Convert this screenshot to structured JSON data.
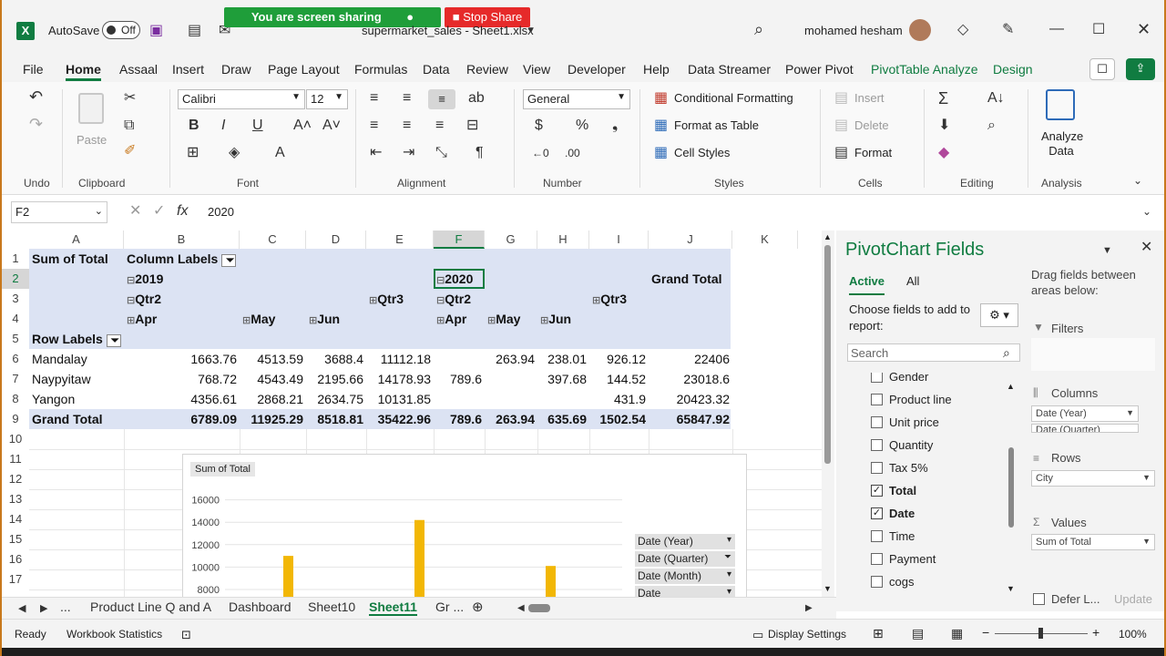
{
  "titlebar": {
    "autosave_label": "AutoSave",
    "toggle_state": "Off",
    "filename": "supermarket_sales - Sheet1.xlsx",
    "sharing_banner": "You are screen sharing",
    "stop_share": "Stop Share",
    "user": "mohamed hesham"
  },
  "menu": [
    "File",
    "Home",
    "Assaal",
    "Insert",
    "Draw",
    "Page Layout",
    "Formulas",
    "Data",
    "Review",
    "View",
    "Developer",
    "Help",
    "Data Streamer",
    "Power Pivot",
    "PivotTable Analyze",
    "Design"
  ],
  "ribbon": {
    "undo": "Undo",
    "clipboard": "Clipboard",
    "paste": "Paste",
    "font_name": "Calibri",
    "font_size": "12",
    "font": "Font",
    "alignment": "Alignment",
    "number_format": "General",
    "number": "Number",
    "cond_format": "Conditional Formatting",
    "format_table": "Format as Table",
    "cell_styles": "Cell Styles",
    "styles": "Styles",
    "insert": "Insert",
    "delete": "Delete",
    "format": "Format",
    "cells": "Cells",
    "editing": "Editing",
    "analyze_data": "Analyze Data",
    "analysis": "Analysis"
  },
  "formula": {
    "namebox": "F2",
    "value": "2020",
    "fx": "fx"
  },
  "columns": [
    "A",
    "B",
    "C",
    "D",
    "E",
    "F",
    "G",
    "H",
    "I",
    "J",
    "K"
  ],
  "rows": [
    "1",
    "2",
    "3",
    "4",
    "5",
    "6",
    "7",
    "8",
    "9",
    "10",
    "11",
    "12",
    "13",
    "14",
    "15",
    "16",
    "17"
  ],
  "pivot": {
    "r1": {
      "a": "Sum of Total",
      "b": "Column Labels"
    },
    "r2": {
      "b": "2019",
      "f": "2020",
      "j": "Grand Total"
    },
    "r3": {
      "b": "Qtr2",
      "e": "Qtr3",
      "f": "Qtr2",
      "i": "Qtr3"
    },
    "r4": {
      "b": "Apr",
      "c": "May",
      "d": "Jun",
      "f": "Apr",
      "g": "May",
      "h": "Jun"
    },
    "r5": {
      "a": "Row Labels"
    },
    "data": [
      {
        "city": "Mandalay",
        "b": "1663.76",
        "c": "4513.59",
        "d": "3688.4",
        "e": "11112.18",
        "f": "",
        "g": "263.94",
        "h": "238.01",
        "i": "926.12",
        "j": "22406"
      },
      {
        "city": "Naypyitaw",
        "b": "768.72",
        "c": "4543.49",
        "d": "2195.66",
        "e": "14178.93",
        "f": "789.6",
        "g": "",
        "h": "397.68",
        "i": "144.52",
        "j": "23018.6"
      },
      {
        "city": "Yangon",
        "b": "4356.61",
        "c": "2868.21",
        "d": "2634.75",
        "e": "10131.85",
        "f": "",
        "g": "",
        "h": "",
        "i": "431.9",
        "j": "20423.32"
      }
    ],
    "total": {
      "city": "Grand Total",
      "b": "6789.09",
      "c": "11925.29",
      "d": "8518.81",
      "e": "35422.96",
      "f": "789.6",
      "g": "263.94",
      "h": "635.69",
      "i": "1502.54",
      "j": "65847.92"
    }
  },
  "chart_data": {
    "type": "bar",
    "title": "Sum of Total",
    "yticks": [
      "16000",
      "14000",
      "12000",
      "10000",
      "8000"
    ],
    "ylim": [
      7000,
      17000
    ],
    "values": [
      11000,
      14200,
      10100
    ],
    "bar_color": "#f2b705",
    "field_buttons": [
      "Date (Year)",
      "Date (Quarter)",
      "Date (Month)",
      "Date"
    ]
  },
  "pane": {
    "title": "PivotChart Fields",
    "tab_active": "Active",
    "tab_all": "All",
    "choose": "Choose fields to add to report:",
    "search_placeholder": "Search",
    "drag": "Drag fields between areas below:",
    "fields": [
      {
        "name": "Gender",
        "checked": false
      },
      {
        "name": "Product line",
        "checked": false
      },
      {
        "name": "Unit price",
        "checked": false
      },
      {
        "name": "Quantity",
        "checked": false
      },
      {
        "name": "Tax 5%",
        "checked": false
      },
      {
        "name": "Total",
        "checked": true
      },
      {
        "name": "Date",
        "checked": true
      },
      {
        "name": "Time",
        "checked": false
      },
      {
        "name": "Payment",
        "checked": false
      },
      {
        "name": "cogs",
        "checked": false
      }
    ],
    "filters": "Filters",
    "columns": "Columns",
    "col_items": [
      "Date (Year)",
      "Date (Quarter)"
    ],
    "rows": "Rows",
    "row_items": [
      "City"
    ],
    "values": "Values",
    "value_items": [
      "Sum of Total"
    ],
    "defer": "Defer L...",
    "update": "Update"
  },
  "sheets": [
    "...",
    "Product Line Q and A",
    "Dashboard",
    "Sheet10",
    "Sheet11",
    "Gr ..."
  ],
  "status": {
    "ready": "Ready",
    "stats": "Workbook Statistics",
    "display": "Display Settings",
    "zoom": "100%"
  }
}
